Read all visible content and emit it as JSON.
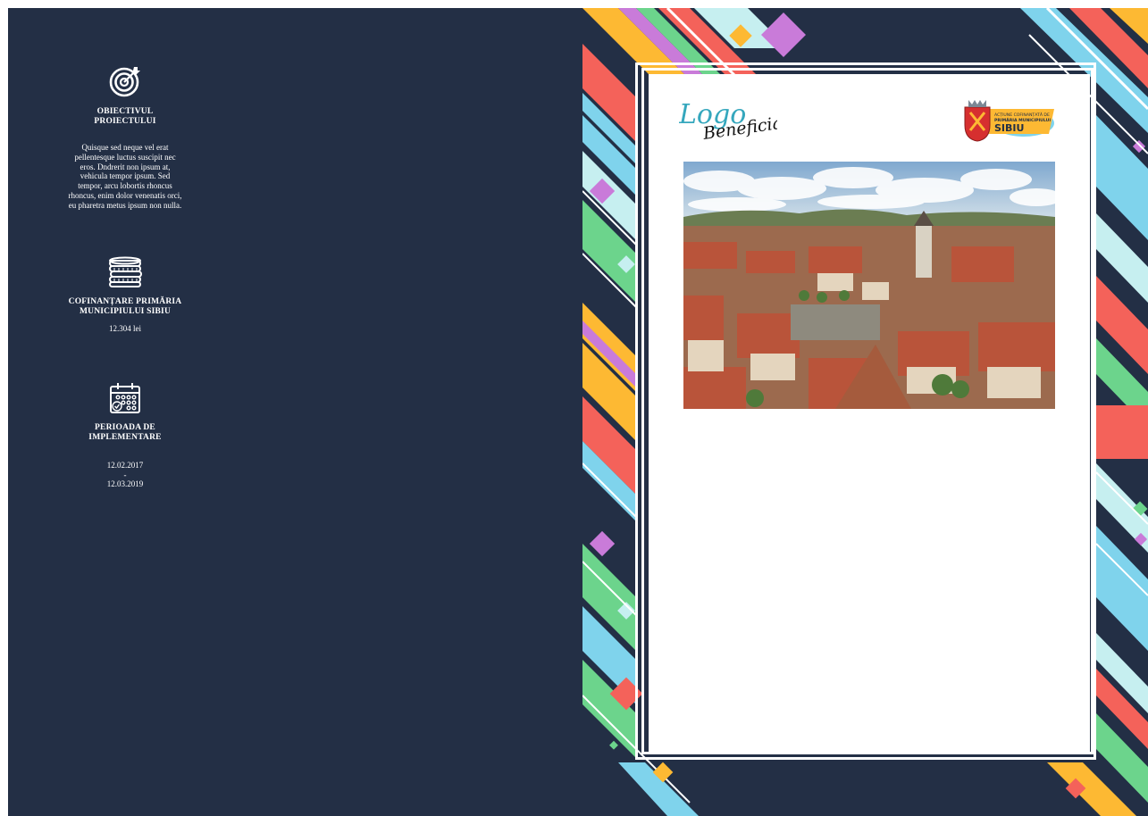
{
  "left_panel": {
    "objective": {
      "icon": "target-icon",
      "heading": "OBIECTIVUL PROIECTULUI",
      "body": "Quisque sed neque vel erat pellentesque luctus suscipit nec eros. Dndrerit non ipsum at, vehicula tempor ipsum. Sed tempor, arcu lobortis rhoncus rhoncus, enim dolor venenatis orci, eu pharetra metus ipsum non nulla."
    },
    "cofinancing": {
      "icon": "coins-icon",
      "heading": "COFINANȚARE PRIMĂRIA MUNICIPIULUI SIBIU",
      "value": "12.304 lei"
    },
    "period": {
      "icon": "calendar-icon",
      "heading": "PERIOADA DE IMPLEMENTARE",
      "start": "12.02.2017",
      "separator": "-",
      "end": "12.03.2019"
    }
  },
  "right_panel": {
    "logo_beneficiar": {
      "line1": "Logo",
      "line2": "Beneficiar"
    },
    "sibiu_logo": {
      "line1": "ACȚIUNE COFINANȚATĂ DE",
      "line2": "PRIMĂRIA MUNICIPIULUI",
      "line3": "SIBIU"
    },
    "photo": {
      "icon": "city-photo"
    }
  },
  "colors": {
    "navy": "#232f45",
    "teal": "#35a7bd",
    "yellow": "#fdb933",
    "red": "#f4625a",
    "green": "#6cd48c",
    "lightblue": "#7fd3ec",
    "purple": "#c97bd9"
  }
}
